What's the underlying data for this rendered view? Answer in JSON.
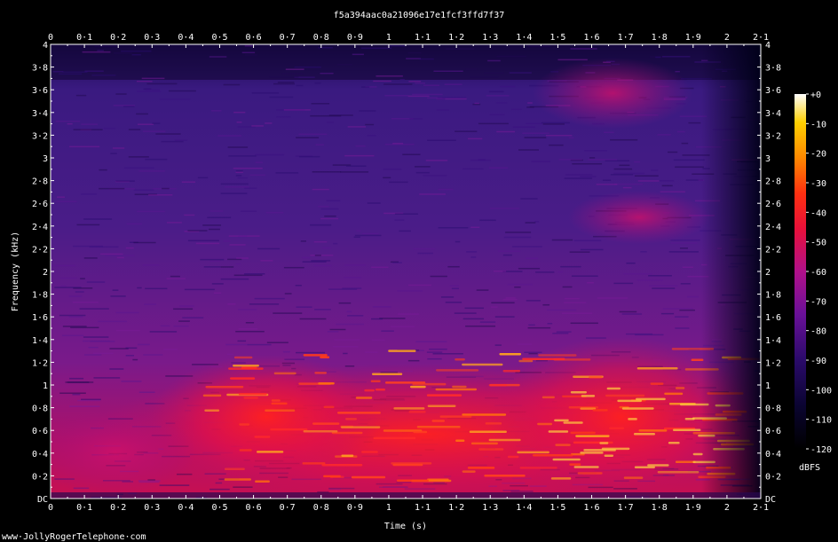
{
  "chart_data": {
    "type": "heatmap",
    "title": "f5a394aac0a21096e17e1fcf3ffd7f37",
    "xlabel": "Time (s)",
    "ylabel": "Frequency (kHz)",
    "x_ticks": [
      "0",
      "0·1",
      "0·2",
      "0·3",
      "0·4",
      "0·5",
      "0·6",
      "0·7",
      "0·8",
      "0·9",
      "1",
      "1·1",
      "1·2",
      "1·3",
      "1·4",
      "1·5",
      "1·6",
      "1·7",
      "1·8",
      "1·9",
      "2",
      "2·1"
    ],
    "y_ticks": [
      "DC",
      "0·2",
      "0·4",
      "0·6",
      "0·8",
      "1",
      "1·2",
      "1·4",
      "1·6",
      "1·8",
      "2",
      "2·2",
      "2·4",
      "2·6",
      "2·8",
      "3",
      "3·2",
      "3·4",
      "3·6",
      "3·8",
      "4"
    ],
    "xlim": [
      0,
      2.1
    ],
    "ylim": [
      0,
      4
    ],
    "colorbar": {
      "label": "dBFS",
      "ticks": [
        "+0",
        "-10",
        "-20",
        "-30",
        "-40",
        "-50",
        "-60",
        "-70",
        "-80",
        "-90",
        "-100",
        "-110",
        "-120"
      ],
      "range": [
        -120,
        0
      ]
    },
    "description": "Spectrogram; energy concentrated below 1.3 kHz between 0.35 s and 1.95 s, with additional energy near 2.4-2.6 kHz and 3.4-3.7 kHz around 1.5-1.9 s."
  },
  "footer": {
    "credit": "www·JollyRogerTelephone·com"
  }
}
